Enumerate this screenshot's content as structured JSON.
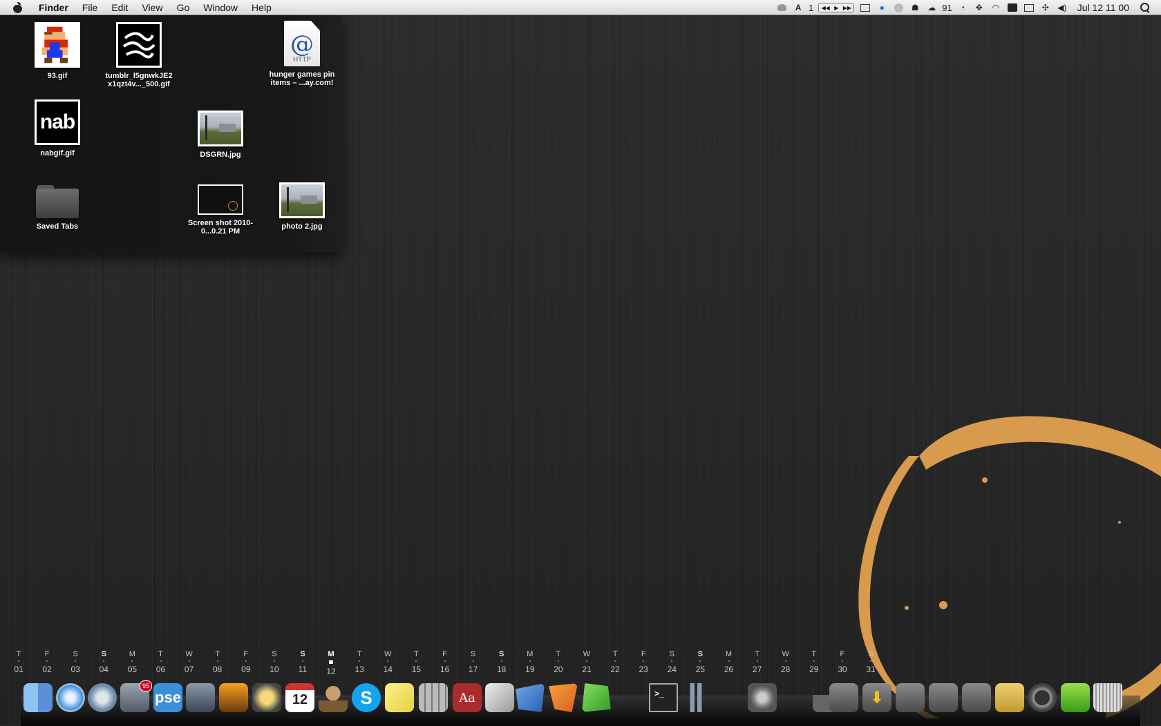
{
  "menubar": {
    "app_name": "Finder",
    "menus": [
      "File",
      "Edit",
      "View",
      "Go",
      "Window",
      "Help"
    ],
    "status": {
      "adobe_count": "1",
      "weather_temp": "91",
      "clock": "Jul 12  11 00"
    }
  },
  "desktop_icons": [
    {
      "label": "93.gif"
    },
    {
      "label": "tumblr_l5gnwkJE2 x1qzt4v..._500.gif"
    },
    {
      "label": "hunger games pin items – ...ay.com!",
      "thumb_text": "HTTP"
    },
    {
      "label": "nabgif.gif",
      "thumb_text": "nab"
    },
    {
      "label": "DSGRN.jpg"
    },
    {
      "label": "Saved Tabs"
    },
    {
      "label": "Screen shot 2010-0...0.21 PM"
    },
    {
      "label": "photo 2.jpg"
    }
  ],
  "calendar": {
    "weekdays": [
      "T",
      "F",
      "S",
      "S",
      "M",
      "T",
      "W",
      "T",
      "F",
      "S",
      "S",
      "M",
      "T",
      "W",
      "T",
      "F",
      "S",
      "S",
      "M",
      "T",
      "W",
      "T",
      "F",
      "S",
      "S",
      "M",
      "T",
      "W",
      "T",
      "F",
      "S"
    ],
    "dates": [
      "01",
      "02",
      "03",
      "04",
      "05",
      "06",
      "07",
      "08",
      "09",
      "10",
      "11",
      "12",
      "13",
      "14",
      "15",
      "16",
      "17",
      "18",
      "19",
      "20",
      "21",
      "22",
      "23",
      "24",
      "25",
      "26",
      "27",
      "28",
      "29",
      "30",
      "31"
    ],
    "today": "12"
  },
  "dock": {
    "mail_badge": "95",
    "pse_label": "pse",
    "ical_date": "12",
    "dictionary_label": "Aa"
  },
  "colors": {
    "coffee": "#d89a4c",
    "menubar": "#e8e8e8",
    "desktop": "#282828"
  }
}
